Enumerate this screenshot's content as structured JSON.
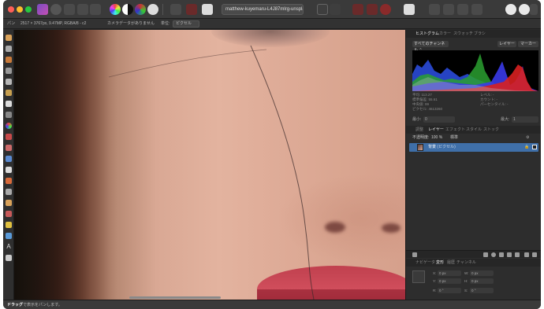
{
  "toolbar": {
    "document_title": "matthew-kuyemaru-L4J87mlrg-unspla"
  },
  "context_bar": {
    "size_info": "2517 × 3767px, 9.47MP, RGBA/8 - c2",
    "camera_info": "カメラデータがありません",
    "unit_label": "単位:",
    "unit_value": "ピクセル"
  },
  "tools_label": "パン",
  "histogram_panel": {
    "tabs": [
      "ヒストグラム",
      "カラー",
      "スウォッチ",
      "ブラシ"
    ],
    "channel_select": "すべてのチャンネル ⌃",
    "layer_button": "レイヤー",
    "marker_button": "マーカー",
    "stats_left": [
      "平均: 113.27",
      "標準偏差: 55.61",
      "中央値: 99",
      "ピクセル: 4613260"
    ],
    "stats_right": [
      "レベル: -",
      "カウント: -",
      "パーセンタイル: -"
    ],
    "min_label": "最小:",
    "min_value": "0",
    "max_label": "最大:",
    "max_value": "1"
  },
  "layers_panel": {
    "tabs": [
      "調整",
      "レイヤー",
      "エフェクト",
      "スタイル",
      "ストック"
    ],
    "blend_label": "不透明度:",
    "opacity_value": "100 %",
    "blend_mode": "標準",
    "layer_name": "背景",
    "layer_type": "(ピクセル)"
  },
  "transform_panel": {
    "tabs": [
      "ナビゲータ",
      "変形",
      "履歴",
      "チャンネル"
    ],
    "x_label": "X:",
    "x_value": "0 px",
    "y_label": "Y:",
    "y_value": "0 px",
    "w_label": "W:",
    "w_value": "0 px",
    "h_label": "H:",
    "h_value": "0 px",
    "r_label": "R:",
    "r_value": "0 °",
    "s_label": "S:",
    "s_value": "0 °"
  },
  "status_bar": {
    "action": "ドラッグ",
    "hint": "で表示をパンします。"
  },
  "colors": {
    "accent": "#3f6fa8",
    "lip": "#c84453",
    "skin": "#deab97"
  }
}
